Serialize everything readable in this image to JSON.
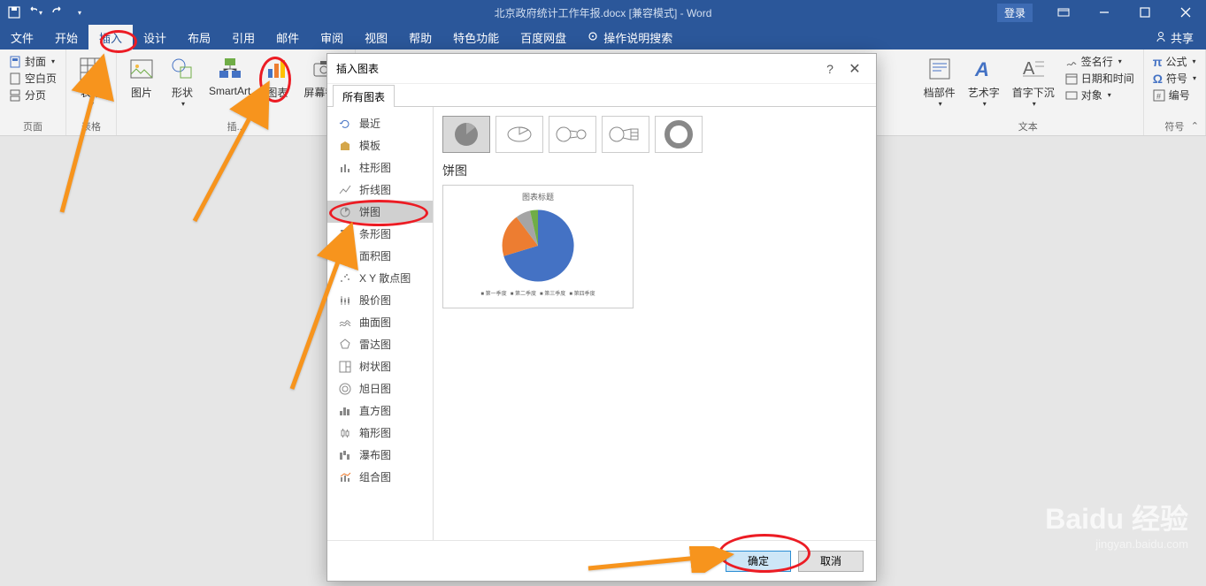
{
  "titlebar": {
    "title": "北京政府统计工作年报.docx [兼容模式] - Word",
    "login": "登录"
  },
  "menu": {
    "file": "文件",
    "home": "开始",
    "insert": "插入",
    "design": "设计",
    "layout": "布局",
    "references": "引用",
    "mailings": "邮件",
    "review": "审阅",
    "view": "视图",
    "help": "帮助",
    "special": "特色功能",
    "baidu": "百度网盘",
    "tellme_placeholder": "操作说明搜索",
    "share": "共享"
  },
  "ribbon": {
    "pages": {
      "cover": "封面",
      "blank": "空白页",
      "break": "分页",
      "label": "页面"
    },
    "tables": {
      "table": "表格",
      "label": "表格"
    },
    "illustrations": {
      "pictures": "图片",
      "shapes": "形状",
      "smartart": "SmartArt",
      "chart": "图表",
      "screenshot": "屏幕截...",
      "label": "插..."
    },
    "text": {
      "parts": "档部件",
      "wordart": "艺术字",
      "dropcap": "首字下沉",
      "label": "文本",
      "signature": "签名行",
      "datetime": "日期和时间",
      "object": "对象"
    },
    "symbols": {
      "equation": "公式",
      "symbol": "符号",
      "number": "编号",
      "label": "符号"
    }
  },
  "dialog": {
    "title": "插入图表",
    "tab_all": "所有图表",
    "types": {
      "recent": "最近",
      "template": "模板",
      "column": "柱形图",
      "line": "折线图",
      "pie": "饼图",
      "bar": "条形图",
      "area": "面积图",
      "scatter": "X Y 散点图",
      "stock": "股价图",
      "surface": "曲面图",
      "radar": "雷达图",
      "treemap": "树状图",
      "sunburst": "旭日图",
      "histogram": "直方图",
      "boxwhisker": "箱形图",
      "waterfall": "瀑布图",
      "combo": "组合图"
    },
    "subtitle": "饼图",
    "preview_title": "图表标题",
    "legend": [
      "第一季度",
      "第二季度",
      "第三季度",
      "第四季度"
    ],
    "ok": "确定",
    "cancel": "取消"
  },
  "watermark": {
    "logo": "Baidu 经验",
    "url": "jingyan.baidu.com"
  },
  "chart_data": {
    "type": "pie",
    "categories": [
      "第一季度",
      "第二季度",
      "第三季度",
      "第四季度"
    ],
    "values": [
      58,
      23,
      10,
      9
    ],
    "title": "图表标题",
    "colors": [
      "#4472c4",
      "#ed7d31",
      "#a5a5a5",
      "#70ad47"
    ]
  }
}
